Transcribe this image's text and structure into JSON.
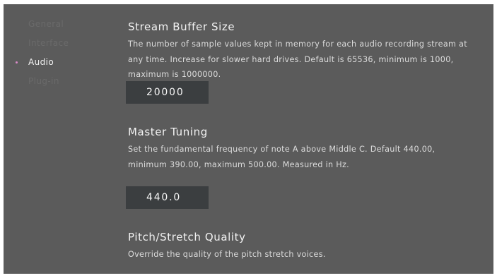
{
  "sidebar": {
    "items": [
      {
        "label": "General",
        "active": false
      },
      {
        "label": "Interface",
        "active": false
      },
      {
        "label": "Audio",
        "active": true
      },
      {
        "label": "Plug-in",
        "active": false
      }
    ]
  },
  "settings": {
    "stream_buffer": {
      "title": "Stream Buffer Size",
      "description": "The number of sample values kept in memory for each audio recording stream at any time. Increase for slower hard drives. Default is 65536, minimum is 1000, maximum is 1000000.",
      "value": "20000"
    },
    "master_tuning": {
      "title": "Master Tuning",
      "description": "Set the fundamental frequency of note A above Middle C. Default 440.00, minimum 390.00, maximum 500.00. Measured in Hz.",
      "value": "440.0"
    },
    "pitch_stretch": {
      "title": "Pitch/Stretch Quality",
      "description": "Override the quality of the pitch stretch voices."
    }
  },
  "colors": {
    "panel_background": "#5b5b5b",
    "value_box_background": "#3b3e40",
    "active_indicator": "#d98ac8",
    "inactive_nav_text": "#6a6a6a",
    "active_nav_text": "#f2f2f2"
  }
}
